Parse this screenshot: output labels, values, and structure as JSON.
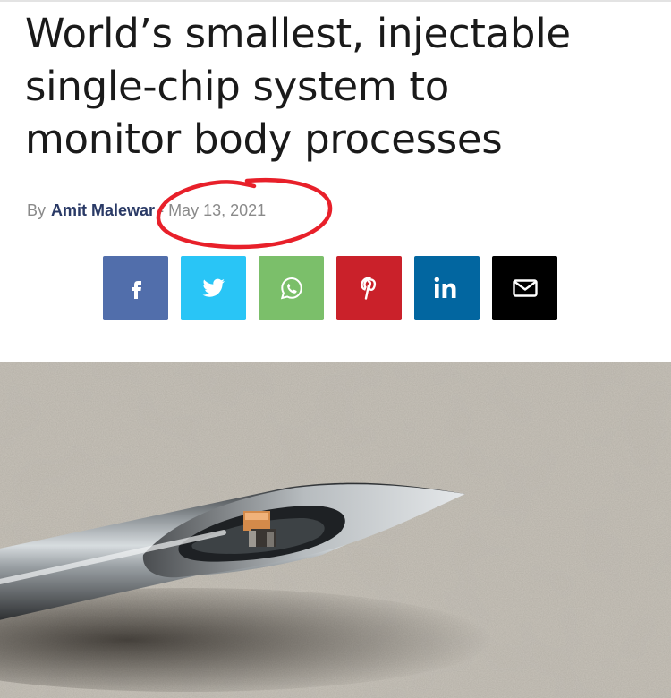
{
  "article": {
    "title_lines": [
      "World’s smallest, injectable",
      "single-chip system to",
      "monitor body processes"
    ],
    "byline_prefix": "By",
    "author": "Amit Malewar",
    "separator": "-",
    "date": "May 13, 2021"
  },
  "share_buttons": [
    {
      "name": "facebook",
      "icon": "facebook-icon",
      "color": "#516eab"
    },
    {
      "name": "twitter",
      "icon": "twitter-icon",
      "color": "#29c5f6"
    },
    {
      "name": "whatsapp",
      "icon": "whatsapp-icon",
      "color": "#7bbf6a"
    },
    {
      "name": "pinterest",
      "icon": "pinterest-icon",
      "color": "#ca212a"
    },
    {
      "name": "linkedin",
      "icon": "linkedin-icon",
      "color": "#0266a0"
    },
    {
      "name": "email",
      "icon": "envelope-icon",
      "color": "#000000"
    }
  ],
  "highlight": {
    "color": "#e8202a"
  },
  "image": {
    "subject": "needle-tip-with-chip-photo"
  }
}
